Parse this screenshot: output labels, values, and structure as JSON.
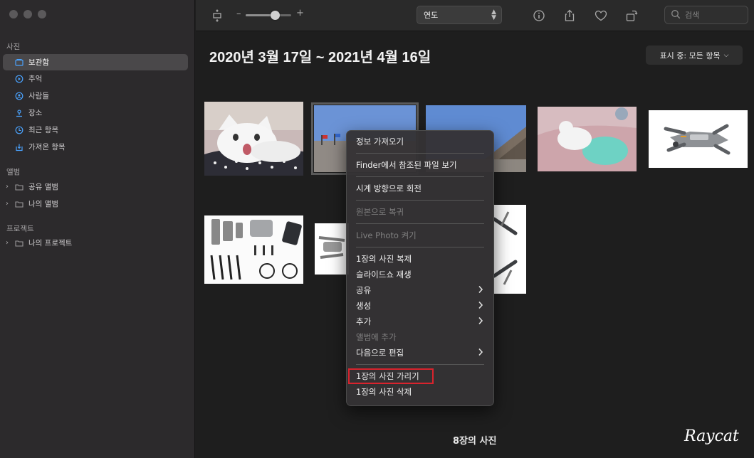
{
  "sidebar": {
    "section_photos": "사진",
    "items": [
      {
        "label": "보관함",
        "icon": "library-icon",
        "active": true
      },
      {
        "label": "추억",
        "icon": "memories-icon",
        "active": false
      },
      {
        "label": "사람들",
        "icon": "people-icon",
        "active": false
      },
      {
        "label": "장소",
        "icon": "places-icon",
        "active": false
      },
      {
        "label": "최근 항목",
        "icon": "recent-icon",
        "active": false
      },
      {
        "label": "가져온 항목",
        "icon": "imports-icon",
        "active": false
      }
    ],
    "section_albums": "앨범",
    "albums": [
      {
        "label": "공유 앨범"
      },
      {
        "label": "나의 앨범"
      }
    ],
    "section_projects": "프로젝트",
    "projects": [
      {
        "label": "나의 프로젝트"
      }
    ]
  },
  "toolbar": {
    "zoom_minus": "–",
    "zoom_plus": "+",
    "zoom_level": 0.65,
    "view_select": "연도",
    "search_placeholder": "검색"
  },
  "main": {
    "title": "2020년 3월 17일 ~ 2021년 4월 16일",
    "filter_label": "표시 중: 모든 항목",
    "count_label": "8장의 사진",
    "watermark_text": "Raycat"
  },
  "context_menu": {
    "items": [
      {
        "label": "정보 가져오기",
        "disabled": false,
        "submenu": false
      },
      {
        "sep": true
      },
      {
        "label": "Finder에서 참조된 파일 보기",
        "disabled": false,
        "submenu": false
      },
      {
        "sep": true
      },
      {
        "label": "시계 방향으로 회전",
        "disabled": false,
        "submenu": false
      },
      {
        "sep": true
      },
      {
        "label": "원본으로 복귀",
        "disabled": true,
        "submenu": false
      },
      {
        "sep": true
      },
      {
        "label": "Live Photo 켜기",
        "disabled": true,
        "submenu": false
      },
      {
        "sep": true
      },
      {
        "label": "1장의 사진 복제",
        "disabled": false,
        "submenu": false
      },
      {
        "label": "슬라이드쇼 재생",
        "disabled": false,
        "submenu": false
      },
      {
        "label": "공유",
        "disabled": false,
        "submenu": true
      },
      {
        "label": "생성",
        "disabled": false,
        "submenu": true
      },
      {
        "label": "추가",
        "disabled": false,
        "submenu": true
      },
      {
        "label": "앨범에 추가",
        "disabled": true,
        "submenu": false
      },
      {
        "label": "다음으로 편집",
        "disabled": false,
        "submenu": true
      },
      {
        "sep": true
      },
      {
        "label": "1장의 사진 가리기",
        "disabled": false,
        "submenu": false,
        "highlight": true
      },
      {
        "label": "1장의 사진 삭제",
        "disabled": false,
        "submenu": false
      }
    ]
  },
  "colors": {
    "sidebar_bg": "#2c2a2c",
    "main_bg": "#1e1e1e",
    "highlight_border": "#d9232d"
  }
}
